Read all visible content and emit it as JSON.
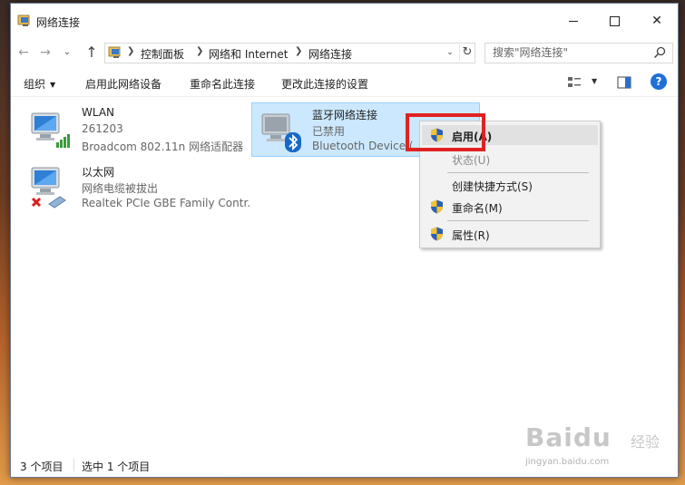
{
  "window": {
    "title": "网络连接"
  },
  "nav": {
    "breadcrumbs": [
      "控制面板",
      "网络和 Internet",
      "网络连接"
    ],
    "search_placeholder": "搜索\"网络连接\""
  },
  "commands": {
    "organize": "组织",
    "enable_device": "启用此网络设备",
    "rename": "重命名此连接",
    "change_settings": "更改此连接的设置"
  },
  "connections": [
    {
      "name": "WLAN",
      "status": "261203",
      "device": "Broadcom 802.11n 网络适配器",
      "type": "wireless"
    },
    {
      "name": "以太网",
      "status": "网络电缆被拔出",
      "device": "Realtek PCIe GBE Family Contr...",
      "type": "ethernet"
    },
    {
      "name": "蓝牙网络连接",
      "status": "已禁用",
      "device": "Bluetooth Device (P",
      "type": "bluetooth",
      "selected": true
    }
  ],
  "context_menu": {
    "items": [
      {
        "label": "启用(A)",
        "shield": true,
        "state": "hover"
      },
      {
        "label": "状态(U)",
        "shield": false,
        "state": "disabled"
      },
      {
        "label": "创建快捷方式(S)",
        "shield": false,
        "state": "normal"
      },
      {
        "label": "重命名(M)",
        "shield": true,
        "state": "normal"
      },
      {
        "label": "属性(R)",
        "shield": true,
        "state": "normal"
      }
    ]
  },
  "statusbar": {
    "item_count": "3 个项目",
    "selected_count": "选中 1 个项目"
  },
  "watermark": {
    "brand": "Baidu",
    "sub": "经验",
    "url": "jingyan.baidu.com"
  },
  "colors": {
    "highlight": "#e02222",
    "selection": "#cce8ff",
    "help": "#1e6fd9"
  }
}
